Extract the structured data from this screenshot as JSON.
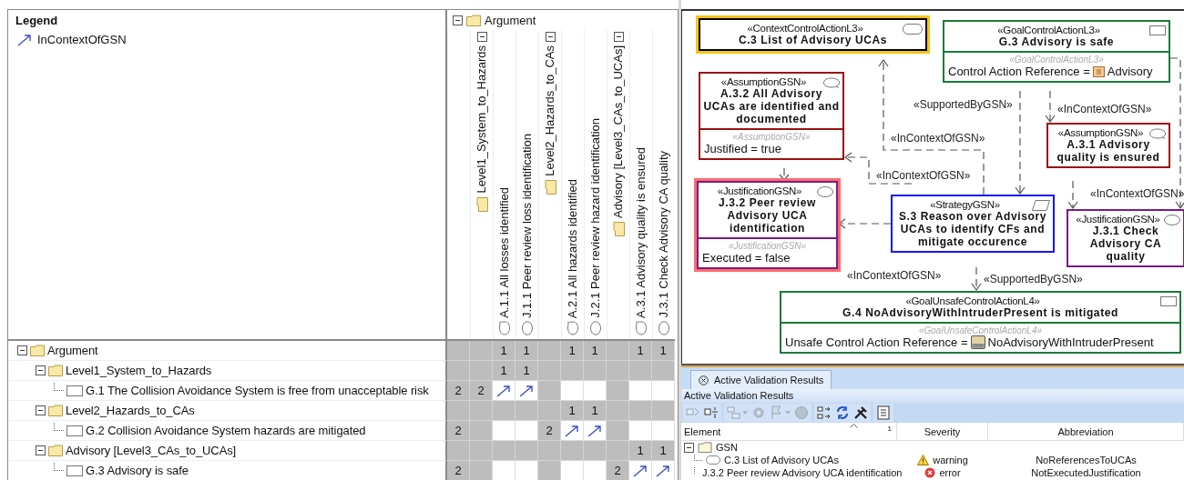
{
  "matrix": {
    "legend": {
      "title": "Legend",
      "items": [
        {
          "label": "InContextOfGSN"
        }
      ]
    },
    "column_tree": {
      "label": "Argument",
      "expanded": true,
      "children": [
        {
          "label": "Level1_System_to_Hazards",
          "expanded": true,
          "children": [
            {
              "label": "A.1.1 All losses identified",
              "kind": "assumption"
            },
            {
              "label": "J.1.1 Peer review loss identification",
              "kind": "justification"
            }
          ]
        },
        {
          "label": "Level2_Hazards_to_CAs",
          "expanded": true,
          "children": [
            {
              "label": "A.2.1 All hazards identified",
              "kind": "assumption"
            },
            {
              "label": "J.2.1 Peer review hazard identification",
              "kind": "justification"
            }
          ]
        },
        {
          "label": "Advisory [Level3_CAs_to_UCAs]",
          "expanded": true,
          "children": [
            {
              "label": "A.3.1 Advisory quality is ensured",
              "kind": "assumption"
            },
            {
              "label": "J.3.1 Check Advisory CA quality",
              "kind": "justification"
            }
          ]
        }
      ]
    },
    "rows": [
      {
        "label": "Argument",
        "kind": "folder",
        "expanded": true,
        "cells": [
          {
            "kind": "blank",
            "shaded": true
          },
          {
            "kind": "blank",
            "shaded": true
          },
          {
            "kind": "count",
            "text": "1",
            "shaded": true
          },
          {
            "kind": "count",
            "text": "1",
            "shaded": true
          },
          {
            "kind": "blank",
            "shaded": true
          },
          {
            "kind": "count",
            "text": "1",
            "shaded": true
          },
          {
            "kind": "count",
            "text": "1",
            "shaded": true
          },
          {
            "kind": "blank",
            "shaded": true
          },
          {
            "kind": "count",
            "text": "1",
            "shaded": true
          },
          {
            "kind": "count",
            "text": "1",
            "shaded": true
          }
        ],
        "children": [
          {
            "label": "Level1_System_to_Hazards",
            "kind": "folder",
            "expanded": true,
            "cells": [
              {
                "kind": "blank",
                "shaded": true
              },
              {
                "kind": "blank",
                "shaded": true
              },
              {
                "kind": "count",
                "text": "1",
                "shaded": true
              },
              {
                "kind": "count",
                "text": "1",
                "shaded": true
              },
              {
                "kind": "blank",
                "shaded": true
              },
              {
                "kind": "blank",
                "shaded": true
              },
              {
                "kind": "blank",
                "shaded": true
              },
              {
                "kind": "blank",
                "shaded": true
              },
              {
                "kind": "blank",
                "shaded": true
              },
              {
                "kind": "blank",
                "shaded": true
              }
            ],
            "children": [
              {
                "label": "G.1 The Collision Avoidance System is free from unacceptable risk",
                "kind": "goal",
                "cells": [
                  {
                    "kind": "count",
                    "text": "2",
                    "shaded": true
                  },
                  {
                    "kind": "count",
                    "text": "2",
                    "shaded": true
                  },
                  {
                    "kind": "relation",
                    "shaded": false
                  },
                  {
                    "kind": "relation",
                    "shaded": false
                  },
                  {
                    "kind": "blank",
                    "shaded": true
                  },
                  {
                    "kind": "blank",
                    "shaded": false
                  },
                  {
                    "kind": "blank",
                    "shaded": false
                  },
                  {
                    "kind": "blank",
                    "shaded": true
                  },
                  {
                    "kind": "blank",
                    "shaded": false
                  },
                  {
                    "kind": "blank",
                    "shaded": false
                  }
                ]
              }
            ]
          },
          {
            "label": "Level2_Hazards_to_CAs",
            "kind": "folder",
            "expanded": true,
            "cells": [
              {
                "kind": "blank",
                "shaded": true
              },
              {
                "kind": "blank",
                "shaded": true
              },
              {
                "kind": "blank",
                "shaded": true
              },
              {
                "kind": "blank",
                "shaded": true
              },
              {
                "kind": "blank",
                "shaded": true
              },
              {
                "kind": "count",
                "text": "1",
                "shaded": true
              },
              {
                "kind": "count",
                "text": "1",
                "shaded": true
              },
              {
                "kind": "blank",
                "shaded": true
              },
              {
                "kind": "blank",
                "shaded": true
              },
              {
                "kind": "blank",
                "shaded": true
              }
            ],
            "children": [
              {
                "label": "G.2 Collision Avoidance System hazards are mitigated",
                "kind": "goal",
                "cells": [
                  {
                    "kind": "count",
                    "text": "2",
                    "shaded": true
                  },
                  {
                    "kind": "blank",
                    "shaded": true
                  },
                  {
                    "kind": "blank",
                    "shaded": false
                  },
                  {
                    "kind": "blank",
                    "shaded": false
                  },
                  {
                    "kind": "count",
                    "text": "2",
                    "shaded": true
                  },
                  {
                    "kind": "relation",
                    "shaded": false
                  },
                  {
                    "kind": "relation",
                    "shaded": false
                  },
                  {
                    "kind": "blank",
                    "shaded": true
                  },
                  {
                    "kind": "blank",
                    "shaded": false
                  },
                  {
                    "kind": "blank",
                    "shaded": false
                  }
                ]
              }
            ]
          },
          {
            "label": "Advisory [Level3_CAs_to_UCAs]",
            "kind": "folder",
            "expanded": true,
            "cells": [
              {
                "kind": "blank",
                "shaded": true
              },
              {
                "kind": "blank",
                "shaded": true
              },
              {
                "kind": "blank",
                "shaded": true
              },
              {
                "kind": "blank",
                "shaded": true
              },
              {
                "kind": "blank",
                "shaded": true
              },
              {
                "kind": "blank",
                "shaded": true
              },
              {
                "kind": "blank",
                "shaded": true
              },
              {
                "kind": "blank",
                "shaded": true
              },
              {
                "kind": "count",
                "text": "1",
                "shaded": true
              },
              {
                "kind": "count",
                "text": "1",
                "shaded": true
              }
            ],
            "children": [
              {
                "label": "G.3 Advisory is safe",
                "kind": "goal",
                "cells": [
                  {
                    "kind": "count",
                    "text": "2",
                    "shaded": true
                  },
                  {
                    "kind": "blank",
                    "shaded": true
                  },
                  {
                    "kind": "blank",
                    "shaded": false
                  },
                  {
                    "kind": "blank",
                    "shaded": false
                  },
                  {
                    "kind": "blank",
                    "shaded": true
                  },
                  {
                    "kind": "blank",
                    "shaded": false
                  },
                  {
                    "kind": "blank",
                    "shaded": false
                  },
                  {
                    "kind": "count",
                    "text": "2",
                    "shaded": true
                  },
                  {
                    "kind": "relation",
                    "shaded": false
                  },
                  {
                    "kind": "relation",
                    "shaded": false
                  }
                ]
              }
            ]
          }
        ]
      }
    ]
  },
  "diagram": {
    "nodes": [
      {
        "kind": "context",
        "stereotype": "«ContextControlActionL3»",
        "name": "C.3 List of Advisory UCAs",
        "highlight": {
          "kind": "warning"
        }
      },
      {
        "kind": "goal",
        "stereotype": "«GoalControlActionL3»",
        "name": "G.3 Advisory is safe",
        "compartment": {
          "stereotype": "«GoalControlActionL3»",
          "property": "Control Action Reference =",
          "value_icon": {
            "kind": "tag"
          },
          "value": "Advisory"
        }
      },
      {
        "kind": "assumption",
        "stereotype": "«AssumptionGSN»",
        "name": "A.3.2 All Advisory UCAs are identified and documented",
        "compartment": {
          "stereotype": "«AssumptionGSN»",
          "property": "Justified = true"
        }
      },
      {
        "kind": "assumption",
        "stereotype": "«AssumptionGSN»",
        "name": "A.3.1 Advisory quality is ensured"
      },
      {
        "kind": "justification",
        "stereotype": "«JustificationGSN»",
        "name": "J.3.2 Peer review Advisory UCA identification",
        "highlight": {
          "kind": "error"
        },
        "compartment": {
          "stereotype": "«JustificationGSN»",
          "property": "Executed = false"
        }
      },
      {
        "kind": "strategy",
        "stereotype": "«StrategyGSN»",
        "name": "S.3 Reason over Advisory UCAs to identify CFs and mitigate occurence"
      },
      {
        "kind": "justification",
        "stereotype": "«JustificationGSN»",
        "name": "J.3.1 Check Advisory CA quality"
      },
      {
        "kind": "goal",
        "stereotype": "«GoalUnsafeControlActionL4»",
        "name": "G.4 NoAdvisoryWithIntruderPresent is mitigated",
        "compartment": {
          "stereotype": "«GoalUnsafeControlActionL4»",
          "property": "Unsafe Control Action Reference =",
          "value_icon": {
            "kind": "block"
          },
          "value": "NoAdvisoryWithIntruderPresent"
        }
      }
    ],
    "edge_labels": [
      "«SupportedByGSN»",
      "«InContextOfGSN»",
      "«InContextOfGSN»",
      "«InContextOfGSN»",
      "«InContextOfGSN»",
      "«InContextOfGSN»",
      "«SupportedByGSN»"
    ]
  },
  "validation": {
    "tab": {
      "label": "Active Validation Results",
      "selected": true
    },
    "title": "Active Validation Results",
    "toolbar": [
      [
        {
          "kind": "expand-tree",
          "disabled": true,
          "menu": false
        },
        {
          "kind": "collapse-tree",
          "disabled": false,
          "menu": false
        }
      ],
      [
        {
          "kind": "navigate",
          "disabled": true,
          "menu": true
        },
        {
          "kind": "gear",
          "disabled": true,
          "menu": false
        },
        {
          "kind": "flag",
          "disabled": true,
          "menu": true
        },
        {
          "kind": "stop",
          "disabled": true,
          "menu": false
        }
      ],
      [
        {
          "kind": "group",
          "disabled": false,
          "menu": false
        },
        {
          "kind": "refresh",
          "disabled": false,
          "menu": false
        },
        {
          "kind": "tools",
          "disabled": false,
          "menu": false
        }
      ],
      [
        {
          "kind": "export",
          "disabled": false,
          "menu": false
        }
      ]
    ],
    "columns": [
      {
        "label": "Element",
        "sort_index": "1"
      },
      {
        "label": "Severity"
      },
      {
        "label": "Abbreviation"
      }
    ],
    "groups": [
      {
        "label": "GSN",
        "expanded": true,
        "results": [
          {
            "element": {
              "kind": "context",
              "label": "C.3 List of Advisory UCAs"
            },
            "severity": {
              "kind": "warning",
              "label": "warning"
            },
            "abbreviation": "NoReferencesToUCAs"
          },
          {
            "element": {
              "kind": "justification",
              "label": "J.3.2 Peer review Advisory UCA identification"
            },
            "severity": {
              "kind": "error",
              "label": "error"
            },
            "abbreviation": "NotExecutedJustification"
          }
        ]
      }
    ]
  }
}
